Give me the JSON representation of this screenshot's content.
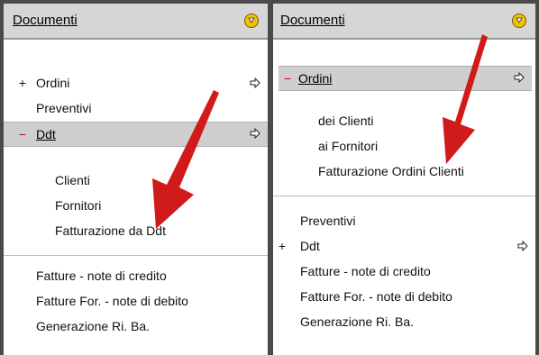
{
  "left_panel": {
    "header": "Documenti",
    "items": [
      {
        "prefix": "+",
        "label": "Ordini"
      },
      {
        "prefix": "",
        "label": "Preventivi"
      },
      {
        "prefix": "−",
        "label": "Ddt"
      }
    ],
    "subitems": [
      "Clienti",
      "Fornitori",
      "Fatturazione da Ddt"
    ],
    "bottom_items": [
      "Fatture - note di credito",
      "Fatture For. - note di debito",
      "Generazione Ri. Ba."
    ]
  },
  "right_panel": {
    "header": "Documenti",
    "items": [
      {
        "prefix": "−",
        "label": "Ordini"
      }
    ],
    "subitems": [
      "dei Clienti",
      "ai Fornitori",
      "Fatturazione Ordini Clienti"
    ],
    "bottom_items": [
      {
        "prefix": "",
        "label": "Preventivi"
      },
      {
        "prefix": "+",
        "label": "Ddt"
      },
      {
        "prefix": "",
        "label": "Fatture - note di credito"
      },
      {
        "prefix": "",
        "label": "Fatture For. - note di debito"
      },
      {
        "prefix": "",
        "label": "Generazione Ri. Ba."
      }
    ]
  },
  "colors": {
    "header_bg": "#d6d6d6",
    "selected_bg": "#cfcfcf",
    "annotation_arrow": "#d11a1a",
    "minus_sign": "#cc0000"
  },
  "icons": {
    "header": "collapse-circle-icon",
    "row_arrow": "right-arrow-icon"
  }
}
